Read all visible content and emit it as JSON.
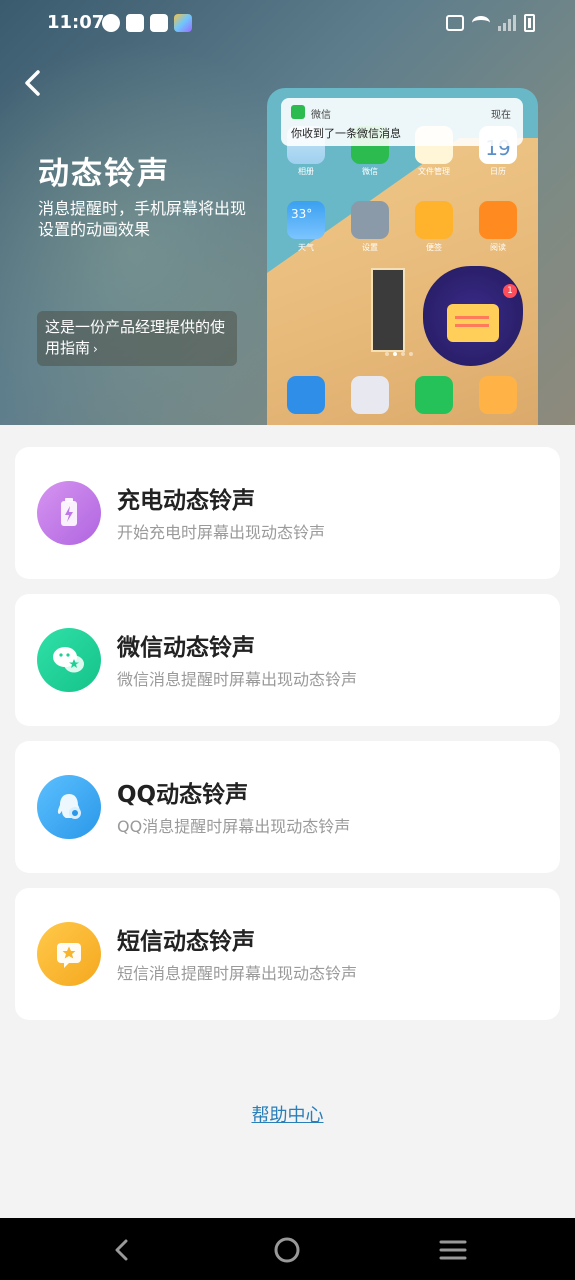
{
  "status_bar": {
    "time": "11:07",
    "left_icons": [
      "speedometer-icon",
      "shopping-bag-icon",
      "shopping-bag-icon",
      "gallery-app-icon"
    ],
    "right_icons": [
      "vibrate-icon",
      "wifi-icon",
      "signal-icon",
      "battery-charging-icon"
    ]
  },
  "header": {
    "title": "动态铃声",
    "description": "消息提醒时，手机屏幕将出现设置的动画效果",
    "guide_text": "这是一份产品经理提供的使用指南",
    "guide_chevron": "›"
  },
  "phone_preview": {
    "notification": {
      "app": "微信",
      "time": "现在",
      "message": "你收到了一条微信消息"
    },
    "apps_row1": [
      "相册",
      "微信",
      "文件管理",
      "日历"
    ],
    "apps_row2": [
      "天气",
      "设置",
      "便签",
      "阅读"
    ],
    "calendar_day": "19",
    "calendar_weekday": "星期三",
    "weather_temp": "33°",
    "badge_count": "1"
  },
  "cards": [
    {
      "title": "充电动态铃声",
      "subtitle": "开始充电时屏幕出现动态铃声",
      "icon": "battery-bolt-icon",
      "color": "#c078e8"
    },
    {
      "title": "微信动态铃声",
      "subtitle": "微信消息提醒时屏幕出现动态铃声",
      "icon": "wechat-icon",
      "color": "#1fcf96"
    },
    {
      "title": "QQ动态铃声",
      "subtitle": "QQ消息提醒时屏幕出现动态铃声",
      "icon": "qq-icon",
      "color": "#3aa8f0"
    },
    {
      "title": "短信动态铃声",
      "subtitle": "短信消息提醒时屏幕出现动态铃声",
      "icon": "sms-star-icon",
      "color": "#f7b42c"
    }
  ],
  "help": {
    "label": "帮助中心"
  },
  "nav": {
    "back": "back-icon",
    "home": "home-icon",
    "menu": "menu-icon"
  }
}
